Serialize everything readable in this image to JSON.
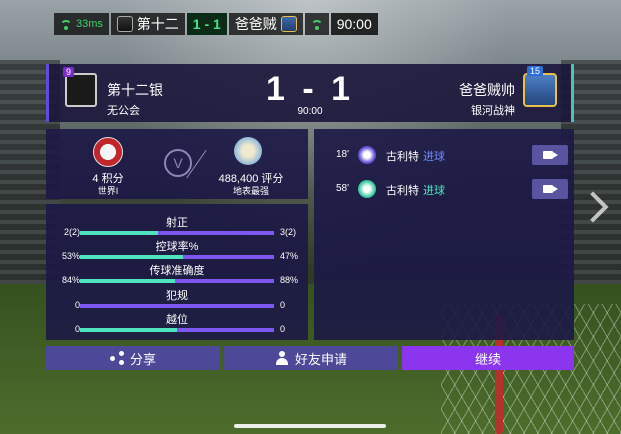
{
  "status_bar": {
    "ping": "33ms",
    "home_team": "第十二",
    "score": "1 - 1",
    "away_team": "爸爸贼",
    "clock": "90:00"
  },
  "match": {
    "home": {
      "name": "第十二银",
      "guild": "无公会",
      "level": "9"
    },
    "away": {
      "name": "爸爸贼帅",
      "guild": "银河战神",
      "level": "15"
    },
    "score": "1 - 1",
    "minute": "90:00"
  },
  "points": {
    "home": {
      "points": "4 积分",
      "rank": "世界I"
    },
    "away": {
      "points": "488,400 评分",
      "rank": "地表最强"
    }
  },
  "stats": [
    {
      "name": "射正",
      "left": "2(2)",
      "right": "3(2)",
      "left_share": 0.4
    },
    {
      "name": "控球率%",
      "left": "53%",
      "right": "47%",
      "left_share": 0.53
    },
    {
      "name": "传球准确度",
      "left": "84%",
      "right": "88%",
      "left_share": 0.49
    },
    {
      "name": "犯规",
      "left": "0",
      "right": "0",
      "left_share": 0.0
    },
    {
      "name": "越位",
      "left": "0",
      "right": "0",
      "left_share": 0.5
    }
  ],
  "events": [
    {
      "minute": "18'",
      "player": "古利特",
      "type": "进球",
      "team": "home",
      "type_color": "#6d8cff"
    },
    {
      "minute": "58'",
      "player": "古利特",
      "type": "进球",
      "team": "away",
      "type_color": "#4ee4bd"
    }
  ],
  "buttons": {
    "share": "分享",
    "friend": "好友申请",
    "continue": "继续"
  },
  "colors": {
    "home_bar": "#4ee4bd",
    "away_bar": "#7e57f0",
    "continue_button": "#8b35ef"
  }
}
